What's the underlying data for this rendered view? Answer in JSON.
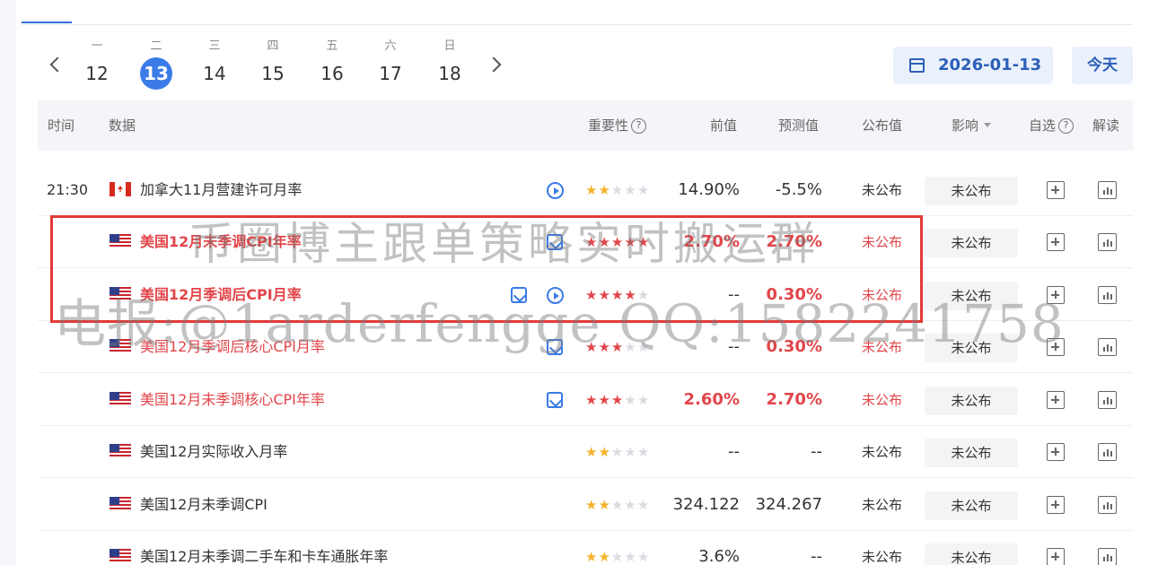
{
  "calendar": {
    "days": [
      {
        "weekday": "一",
        "day": "12"
      },
      {
        "weekday": "二",
        "day": "13"
      },
      {
        "weekday": "三",
        "day": "14"
      },
      {
        "weekday": "四",
        "day": "15"
      },
      {
        "weekday": "五",
        "day": "16"
      },
      {
        "weekday": "六",
        "day": "17"
      },
      {
        "weekday": "日",
        "day": "18"
      }
    ],
    "selected_day": "13",
    "date_value": "2026-01-13",
    "today_label": "今天"
  },
  "table": {
    "headers": {
      "time": "时间",
      "data": "数据",
      "importance": "重要性",
      "previous": "前值",
      "forecast": "预测值",
      "published": "公布值",
      "impact": "影响",
      "watch": "自选",
      "interpret": "解读",
      "help_mark": "?"
    },
    "rows": [
      {
        "time": "21:30",
        "flag": "CA",
        "name": "加拿大11月营建许可月率",
        "stars": 2,
        "previous": "14.90%",
        "forecast": "-5.5%",
        "published": "未公布",
        "impact": "未公布"
      },
      {
        "time": "",
        "flag": "US",
        "name": "美国12月未季调CPI年率",
        "stars": 5,
        "previous": "2.70%",
        "forecast": "2.70%",
        "published": "未公布",
        "impact": "未公布"
      },
      {
        "time": "",
        "flag": "US",
        "name": "美国12月季调后CPI月率",
        "stars": 4,
        "previous": "--",
        "forecast": "0.30%",
        "published": "未公布",
        "impact": "未公布"
      },
      {
        "time": "",
        "flag": "US",
        "name": "美国12月季调后核心CPI月率",
        "stars": 3,
        "previous": "--",
        "forecast": "0.30%",
        "published": "未公布",
        "impact": "未公布"
      },
      {
        "time": "",
        "flag": "US",
        "name": "美国12月未季调核心CPI年率",
        "stars": 3,
        "previous": "2.60%",
        "forecast": "2.70%",
        "published": "未公布",
        "impact": "未公布"
      },
      {
        "time": "",
        "flag": "US",
        "name": "美国12月实际收入月率",
        "stars": 2,
        "previous": "--",
        "forecast": "--",
        "published": "未公布",
        "impact": "未公布"
      },
      {
        "time": "",
        "flag": "US",
        "name": "美国12月未季调CPI",
        "stars": 2,
        "previous": "324.122",
        "forecast": "324.267",
        "published": "未公布",
        "impact": "未公布"
      },
      {
        "time": "",
        "flag": "US",
        "name": "美国12月未季调二手车和卡车通胀年率",
        "stars": 2,
        "previous": "3.6%",
        "forecast": "--",
        "published": "未公布",
        "impact": "未公布"
      }
    ]
  },
  "watermark": {
    "line1": "币圈博主跟单策略实时搬运群",
    "line2": "电报:@1arderfengge QQ:1582241758"
  },
  "colors": {
    "accent": "#3b7be8",
    "highlight": "#e2454a",
    "star": "#f3b22a",
    "annotation_box": "#e33a38"
  }
}
